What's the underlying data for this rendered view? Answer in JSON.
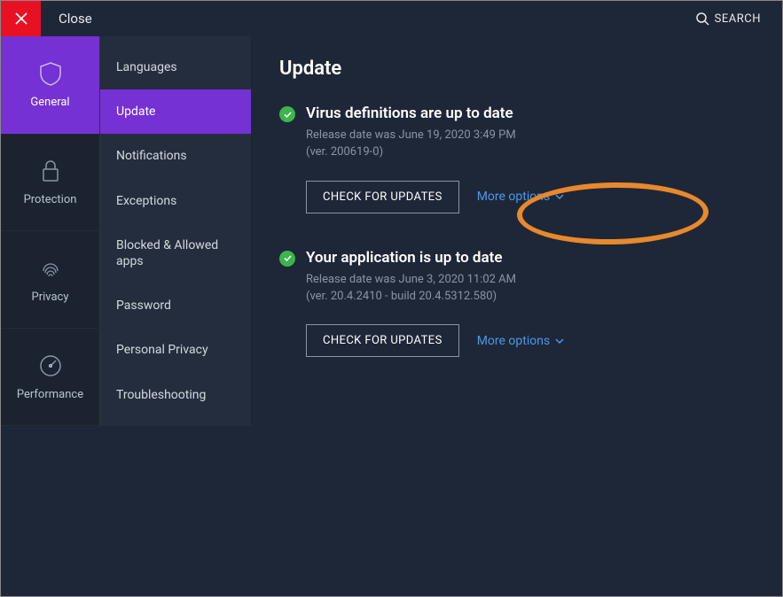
{
  "topbar": {
    "close_label": "Close",
    "search_label": "SEARCH"
  },
  "nav": {
    "items": [
      {
        "label": "General"
      },
      {
        "label": "Protection"
      },
      {
        "label": "Privacy"
      },
      {
        "label": "Performance"
      }
    ]
  },
  "subnav": {
    "items": [
      {
        "label": "Languages"
      },
      {
        "label": "Update"
      },
      {
        "label": "Notifications"
      },
      {
        "label": "Exceptions"
      },
      {
        "label": "Blocked & Allowed apps"
      },
      {
        "label": "Password"
      },
      {
        "label": "Personal Privacy"
      },
      {
        "label": "Troubleshooting"
      }
    ]
  },
  "page": {
    "title": "Update",
    "sections": [
      {
        "heading": "Virus definitions are up to date",
        "sub_line1": "Release date was June 19, 2020 3:49 PM",
        "sub_line2": "(ver. 200619-0)",
        "button": "CHECK FOR UPDATES",
        "more": "More options"
      },
      {
        "heading": "Your application is up to date",
        "sub_line1": "Release date was June 3, 2020 11:02 AM",
        "sub_line2": "(ver. 20.4.2410 - build 20.4.5312.580)",
        "button": "CHECK FOR UPDATES",
        "more": "More options"
      }
    ]
  },
  "colors": {
    "accent": "#7531d4",
    "success": "#3cb54a",
    "link": "#4b98e8",
    "highlight": "#e7892c"
  }
}
